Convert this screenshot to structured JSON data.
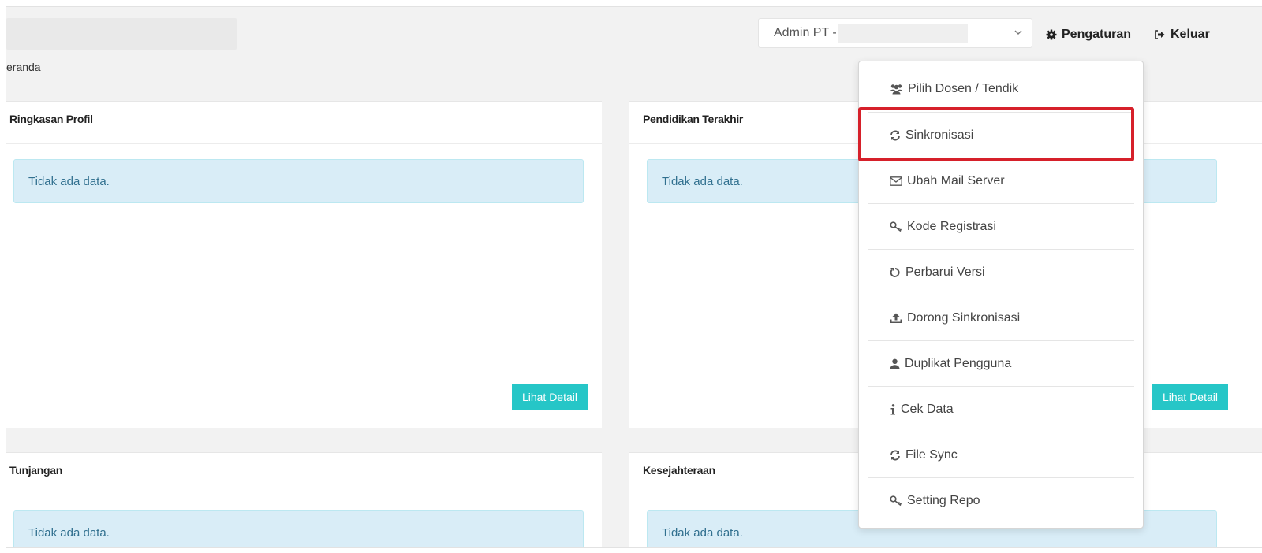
{
  "breadcrumb": "eranda",
  "header": {
    "role_select_value": "Admin PT -",
    "settings_label": "Pengaturan",
    "logout_label": "Keluar"
  },
  "cards": {
    "profile": {
      "title": "Ringkasan Profil",
      "empty": "Tidak ada data.",
      "button": "Lihat Detail"
    },
    "education": {
      "title": "Pendidikan Terakhir",
      "empty": "Tidak ada data.",
      "button": "Lihat Detail"
    },
    "allowance": {
      "title": "Tunjangan",
      "empty": "Tidak ada data."
    },
    "welfare": {
      "title": "Kesejahteraan",
      "empty": "Tidak ada data."
    }
  },
  "settings_menu": {
    "items": [
      {
        "label": "Pilih Dosen / Tendik",
        "icon": "users-icon"
      },
      {
        "label": "Sinkronisasi",
        "icon": "refresh-icon"
      },
      {
        "label": "Ubah Mail Server",
        "icon": "envelope-icon"
      },
      {
        "label": "Kode Registrasi",
        "icon": "key-icon"
      },
      {
        "label": "Perbarui Versi",
        "icon": "rotate-icon"
      },
      {
        "label": "Dorong Sinkronisasi",
        "icon": "upload-icon"
      },
      {
        "label": "Duplikat Pengguna",
        "icon": "user-icon"
      },
      {
        "label": "Cek Data",
        "icon": "info-icon"
      },
      {
        "label": "File Sync",
        "icon": "refresh-icon"
      },
      {
        "label": "Setting Repo",
        "icon": "key-icon"
      }
    ],
    "highlighted_item": "Sinkronisasi",
    "highlight_color": "#d6202a"
  },
  "colors": {
    "accent_button": "#26c6c7",
    "alert_bg": "#d9edf7",
    "alert_text": "#31708f"
  }
}
